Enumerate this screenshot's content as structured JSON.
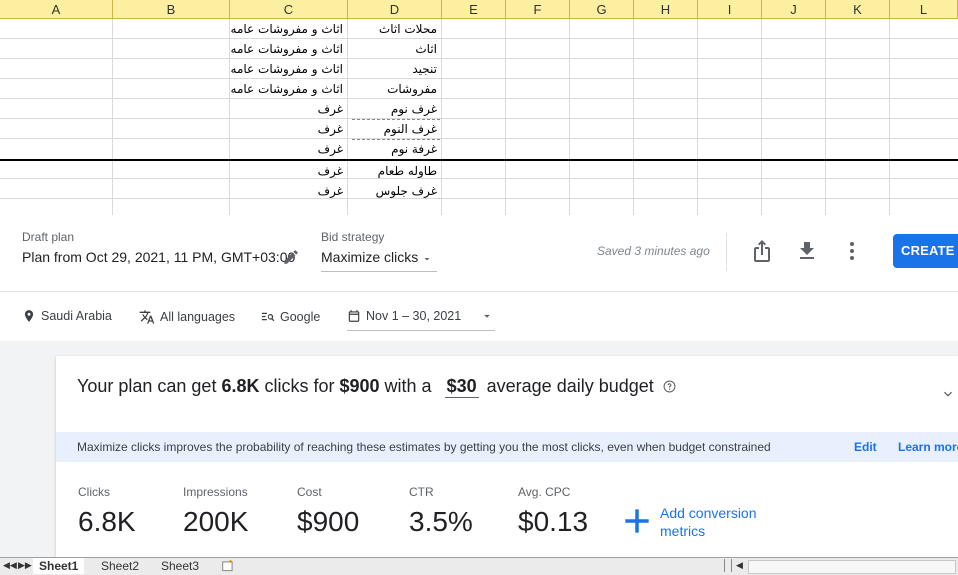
{
  "sheet": {
    "columns": [
      "A",
      "B",
      "C",
      "D",
      "E",
      "F",
      "G",
      "H",
      "I",
      "J",
      "K",
      "L"
    ],
    "rows": [
      {
        "c": "اثاث و مفروشات عامه",
        "d": "محلات اثاث"
      },
      {
        "c": "اثاث و مفروشات عامه",
        "d": "اثاث"
      },
      {
        "c": "اثاث و مفروشات عامه",
        "d": "تنجيد"
      },
      {
        "c": "اثاث و مفروشات عامه",
        "d": "مفروشات"
      },
      {
        "c": "غرف",
        "d": "غرف نوم"
      },
      {
        "c": "غرف",
        "d": "غرف النوم"
      },
      {
        "c": "غرف",
        "d": "غرفة نوم"
      },
      {
        "c": "غرف",
        "d": "طاوله طعام"
      },
      {
        "c": "غرف",
        "d": "غرف جلوس"
      }
    ],
    "tabs": [
      "Sheet1",
      "Sheet2",
      "Sheet3"
    ]
  },
  "ads": {
    "draft_label": "Draft plan",
    "plan_name": "Plan from Oct 29, 2021, 11 PM, GMT+03:00",
    "bid_label": "Bid strategy",
    "bid_value": "Maximize clicks",
    "saved": "Saved 3 minutes ago",
    "create_label": "CREATE C",
    "filters": {
      "location": "Saudi Arabia",
      "language": "All languages",
      "network": "Google",
      "dates": "Nov 1 – 30, 2021"
    },
    "headline": {
      "pre": "Your plan can get ",
      "clicks": "6.8K",
      "mid1": " clicks for ",
      "cost": "$900",
      "mid2": " with a",
      "budget": "$30",
      "post": "average daily budget"
    },
    "banner": {
      "text": "Maximize clicks improves the probability of reaching these estimates by getting you the most clicks, even when budget constrained",
      "edit": "Edit",
      "learn": "Learn more"
    },
    "metrics": [
      {
        "label": "Clicks",
        "value": "6.8K"
      },
      {
        "label": "Impressions",
        "value": "200K"
      },
      {
        "label": "Cost",
        "value": "$900"
      },
      {
        "label": "CTR",
        "value": "3.5%"
      },
      {
        "label": "Avg. CPC",
        "value": "$0.13"
      }
    ],
    "add_conversion_line1": "Add conversion",
    "add_conversion_line2": "metrics"
  }
}
